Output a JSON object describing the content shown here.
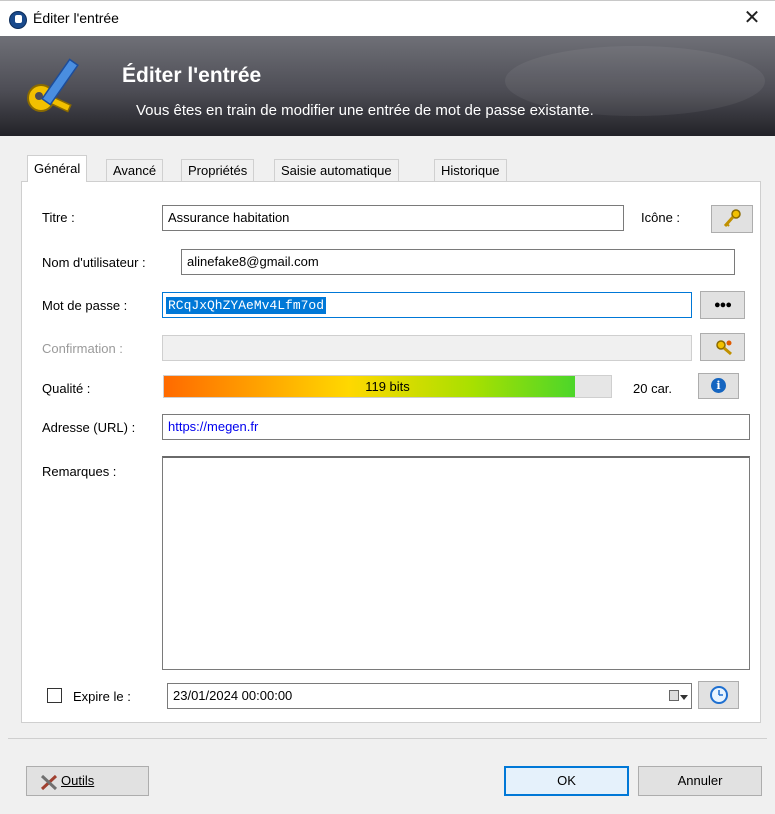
{
  "window": {
    "title": "Éditer l'entrée",
    "close": "✕"
  },
  "banner": {
    "heading": "Éditer l'entrée",
    "subtitle": "Vous êtes en train de modifier une entrée de mot de passe existante."
  },
  "tabs": [
    {
      "label": "Général",
      "active": true
    },
    {
      "label": "Avancé"
    },
    {
      "label": "Propriétés"
    },
    {
      "label": "Saisie automatique"
    },
    {
      "label": "Historique"
    }
  ],
  "form": {
    "title_label": "Titre :",
    "title_value": "Assurance habitation",
    "icon_label": "Icône :",
    "user_label": "Nom d'utilisateur :",
    "user_value": "alinefake8@gmail.com",
    "password_label": "Mot de passe :",
    "password_value": "RCqJxQhZYAeMv4Lfm7od",
    "dots": "●●●",
    "confirm_label": "Confirmation :",
    "quality_label": "Qualité :",
    "quality_text": "119 bits",
    "quality_fraction": 0.92,
    "chars": "20 car.",
    "url_label": "Adresse (URL) :",
    "url_value": "https://megen.fr",
    "notes_label": "Remarques :",
    "expire_label": "Expire le :",
    "expire_value": "23/01/2024 00:00:00"
  },
  "footer": {
    "tools": "Outils",
    "ok": "OK",
    "cancel": "Annuler"
  }
}
